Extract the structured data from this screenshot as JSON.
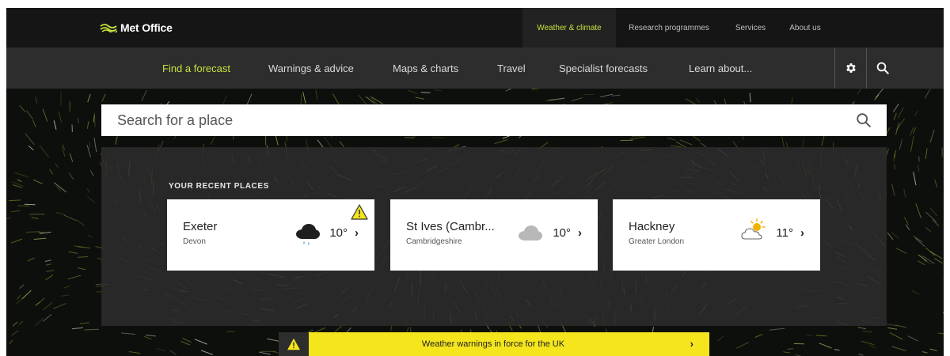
{
  "brand": {
    "name": "Met Office"
  },
  "top_nav": [
    {
      "label": "Weather & climate",
      "active": true
    },
    {
      "label": "Research programmes"
    },
    {
      "label": "Services"
    },
    {
      "label": "About us"
    }
  ],
  "main_nav": [
    {
      "label": "Find a forecast",
      "active": true
    },
    {
      "label": "Warnings & advice"
    },
    {
      "label": "Maps & charts"
    },
    {
      "label": "Travel"
    },
    {
      "label": "Specialist forecasts"
    },
    {
      "label": "Learn about..."
    }
  ],
  "toolbar": {
    "settings_icon": "gear-icon",
    "search_icon": "search-icon"
  },
  "search": {
    "placeholder": "Search for a place",
    "value": ""
  },
  "recent": {
    "title": "YOUR RECENT PLACES",
    "places": [
      {
        "name": "Exeter",
        "region": "Devon",
        "temp": "10°",
        "icon": "heavy-rain-cloud-icon",
        "warning": true
      },
      {
        "name": "St Ives (Cambr...",
        "region": "Cambridgeshire",
        "temp": "10°",
        "icon": "cloud-icon",
        "warning": false
      },
      {
        "name": "Hackney",
        "region": "Greater London",
        "temp": "11°",
        "icon": "sun-behind-cloud-icon",
        "warning": false
      }
    ]
  },
  "warning_banner": {
    "text": "Weather warnings in force for the UK"
  },
  "colors": {
    "accent": "#c8e03c",
    "warning_yellow": "#f5e51d",
    "top_bar": "#151515",
    "main_nav": "#2d2d2d",
    "rain_drop": "#3aa0d8",
    "sun": "#f0b400"
  }
}
